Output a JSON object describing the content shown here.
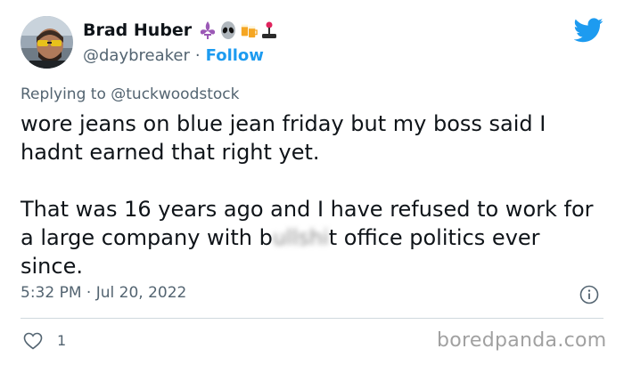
{
  "author": {
    "display_name": "Brad Huber",
    "handle": "@daybreaker",
    "separator": "·",
    "follow_label": "Follow",
    "name_emojis": [
      "fleur-de-lis-icon",
      "alien-icon",
      "beer-mugs-icon",
      "joystick-icon"
    ]
  },
  "reply": {
    "prefix": "Replying to",
    "mention": "@tuckwoodstock"
  },
  "tweet": {
    "line1": "wore jeans on blue jean friday but my boss said I hadnt earned that right yet.",
    "para2_start": "That was 16 years ago and I have refused to work for a large company with b",
    "para2_blurred": "ullshi",
    "para2_end": "t office politics ever since."
  },
  "meta": {
    "timestamp": "5:32 PM · Jul 20, 2022"
  },
  "actions": {
    "like_count": "1"
  },
  "watermark": "boredpanda.com",
  "colors": {
    "twitter_blue": "#1d9bf0",
    "secondary_text": "#536471",
    "divider": "#cfd9de"
  }
}
